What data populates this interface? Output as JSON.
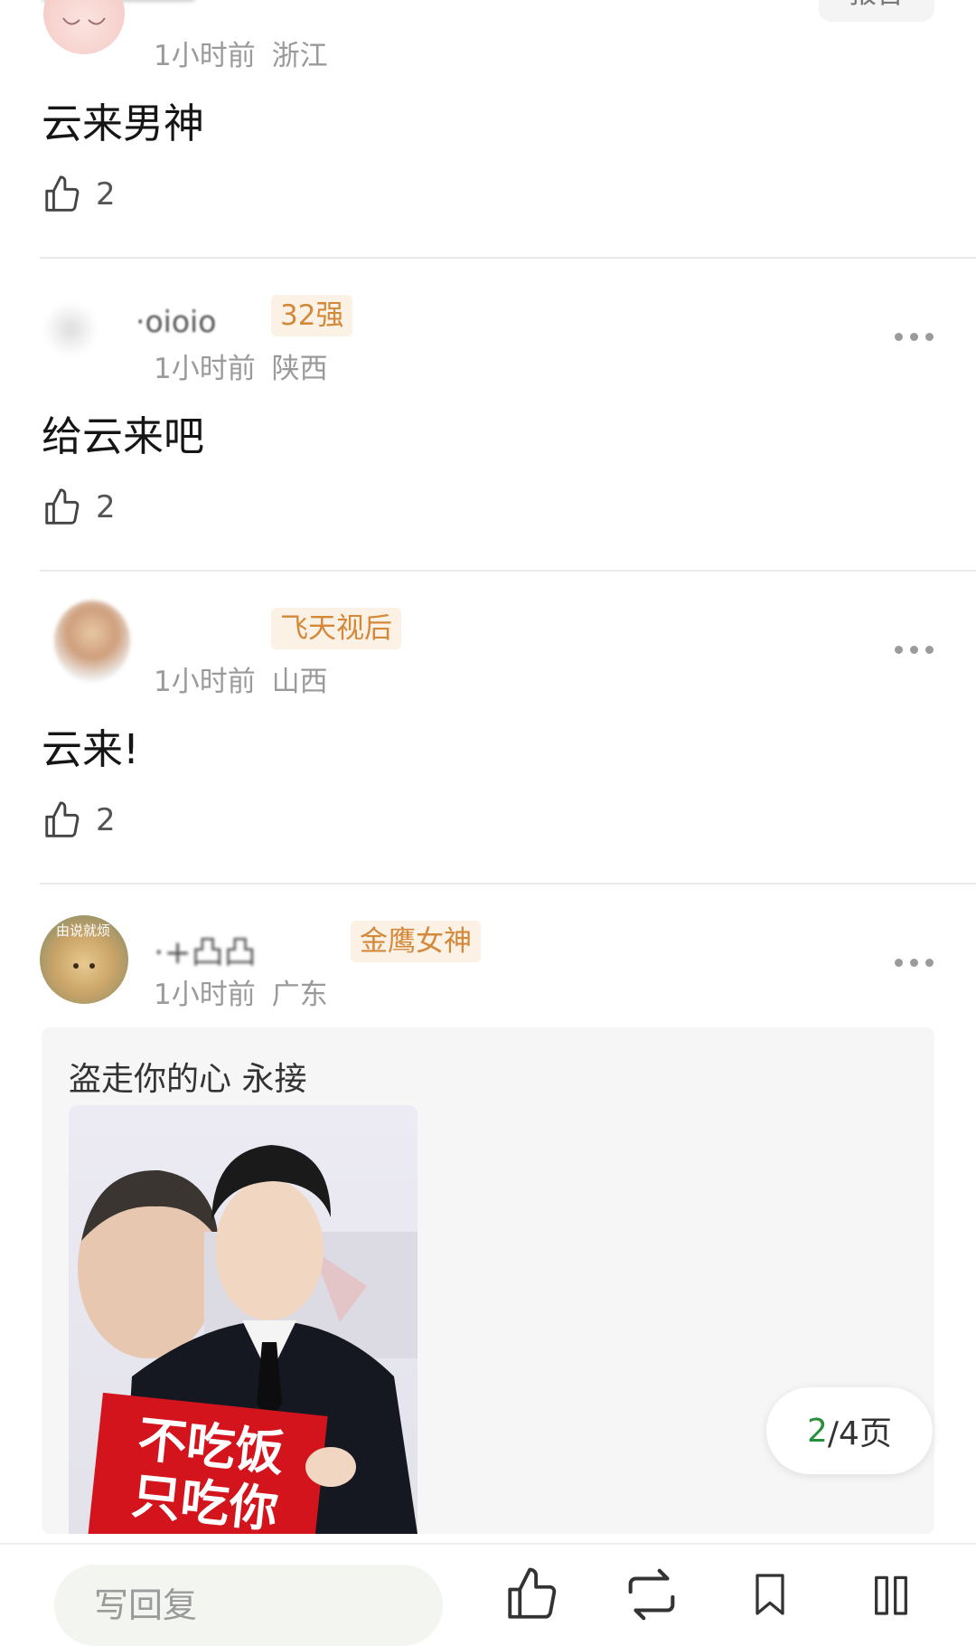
{
  "header_partial": {
    "top_button_label": "报告"
  },
  "comments": [
    {
      "time": "1小时前",
      "location": "浙江",
      "content": "云来男神",
      "likes": "2"
    },
    {
      "username_partial": "·oioio",
      "badge": "32强",
      "time": "1小时前",
      "location": "陕西",
      "content": "给云来吧",
      "likes": "2"
    },
    {
      "badge": "飞天视后",
      "time": "1小时前",
      "location": "山西",
      "content": "云来!",
      "likes": "2"
    },
    {
      "username_partial": "·+凸凸",
      "badge": "金鹰女神",
      "time": "1小时前",
      "location": "广东",
      "quote": "盗走你的心 永接",
      "avatar_text": "由说就烦",
      "photo_sign_line1": "不吃饭",
      "photo_sign_line2": "只吃你"
    }
  ],
  "pagination": {
    "current": "2",
    "separator_total": "/4页"
  },
  "bottom_bar": {
    "reply_placeholder": "写回复"
  },
  "icons": {
    "like": "thumbs-up-icon",
    "more": "more-dots-icon",
    "share": "repost-icon",
    "bookmark": "bookmark-icon",
    "menu": "columns-icon"
  },
  "colors": {
    "badge_text": "#d4883a",
    "badge_bg": "#fbf1e4",
    "page_current": "#2a8f3a"
  }
}
